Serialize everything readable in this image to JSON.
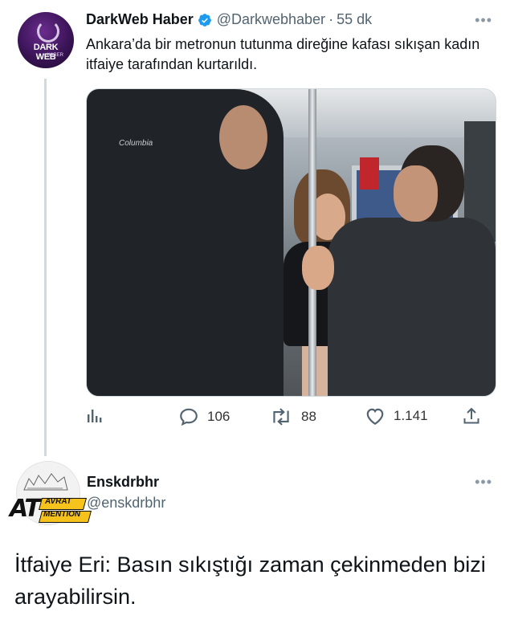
{
  "tweet": {
    "author_name": "DarkWeb Haber",
    "handle": "@Darkwebhaber",
    "separator": "·",
    "time": "55 dk",
    "verified": true,
    "avatar_line1": "DARK WEB",
    "avatar_line2": "HABER",
    "text": "Ankara’da bir metronun tutunma direğine kafası sıkışan kadın itfaiye tarafından kurtarıldı.",
    "media_brand_text": "Columbia",
    "actions": {
      "replies": "106",
      "retweets": "88",
      "likes": "1.141"
    },
    "icons": {
      "analytics": "analytics-icon",
      "reply": "reply-icon",
      "retweet": "retweet-icon",
      "like": "heart-icon",
      "share": "share-icon",
      "more": "more-icon"
    },
    "more_label": "•••"
  },
  "reply": {
    "author_name": "Enskdrbhr",
    "handle": "@enskdrbhr",
    "badge_big": "AT",
    "badge_line1": "AVRAT",
    "badge_line2": "MENTION",
    "more_label": "•••",
    "text": "İtfaiye Eri: Basın sıkıştığı zaman çekinmeden bizi arayabilirsin."
  },
  "colors": {
    "verified_blue": "#1d9bf0",
    "secondary_text": "#536471",
    "thread_line": "#cfd9de",
    "badge_yellow": "#f6c21c"
  }
}
